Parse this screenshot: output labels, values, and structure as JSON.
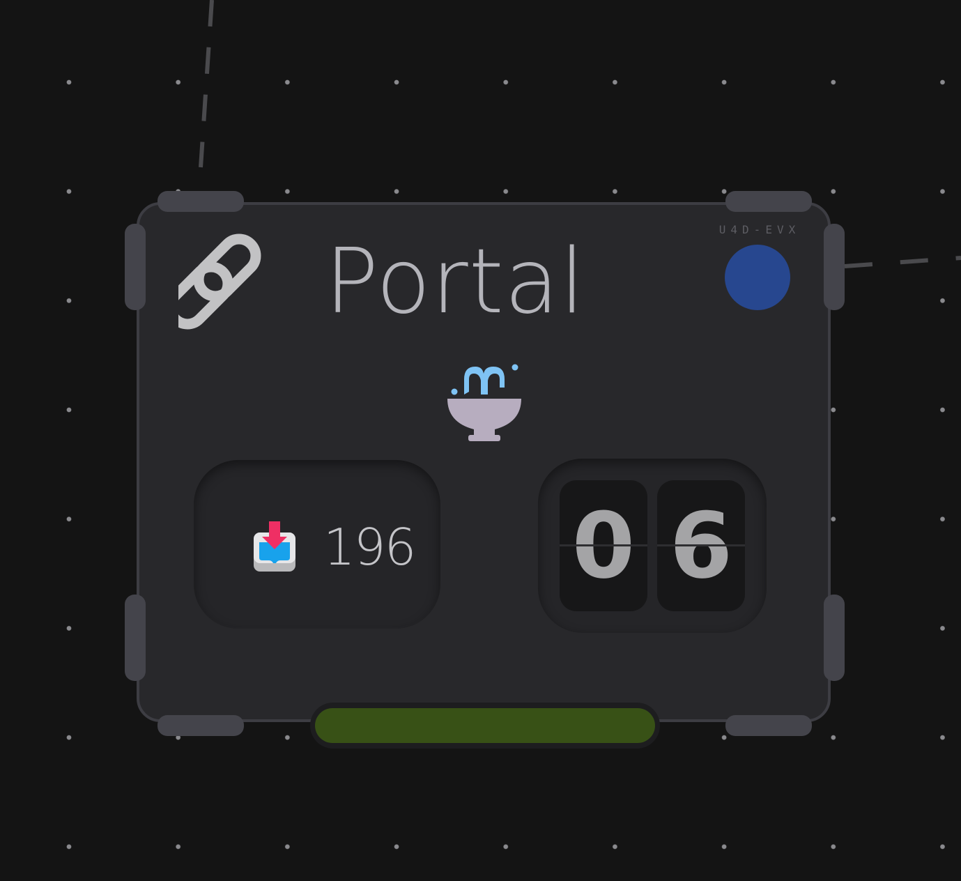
{
  "canvas": {
    "background": "#141414",
    "grid_dot_color": "#8a8a8e"
  },
  "node": {
    "title": "Portal",
    "title_icon": "link-icon",
    "node_id": "U4D-EVX",
    "status_color": "#27478f",
    "center_icon": "fountain-icon",
    "counter": {
      "icon": "inbox-download-icon",
      "value": "196"
    },
    "flip_counter": {
      "digits": [
        "0",
        "6"
      ]
    },
    "progress": {
      "value": 1.0,
      "color": "#385116"
    }
  }
}
